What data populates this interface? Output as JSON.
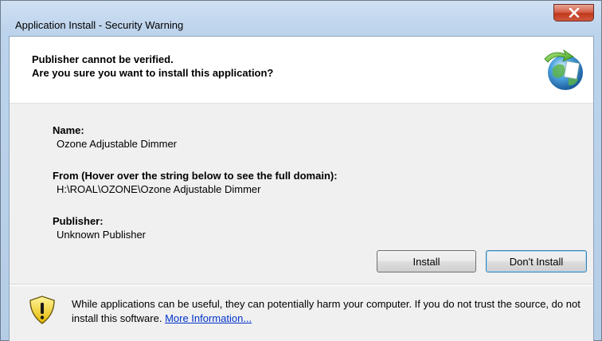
{
  "window": {
    "title": "Application Install - Security Warning"
  },
  "header": {
    "line1": "Publisher cannot be verified.",
    "line2": "Are you sure you want to install this application?",
    "icon": "application-install-globe-icon"
  },
  "details": {
    "name_label": "Name:",
    "name_value": "Ozone Adjustable Dimmer",
    "from_label": "From (Hover over the string below to see the full domain):",
    "from_value": "H:\\ROAL\\OZONE\\Ozone Adjustable Dimmer",
    "publisher_label": "Publisher:",
    "publisher_value": "Unknown Publisher"
  },
  "buttons": {
    "install": "Install",
    "dont_install": "Don't Install"
  },
  "footer": {
    "icon": "security-shield-warning-icon",
    "warning_text": "While applications can be useful, they can potentially harm your computer. If you do not trust the source, do not install this software.",
    "more_info_link": "More Information..."
  },
  "colors": {
    "title_bar": "#bcd3ec",
    "close_button": "#c2381c",
    "link": "#0033cc",
    "default_button_border": "#3c7fb1"
  }
}
